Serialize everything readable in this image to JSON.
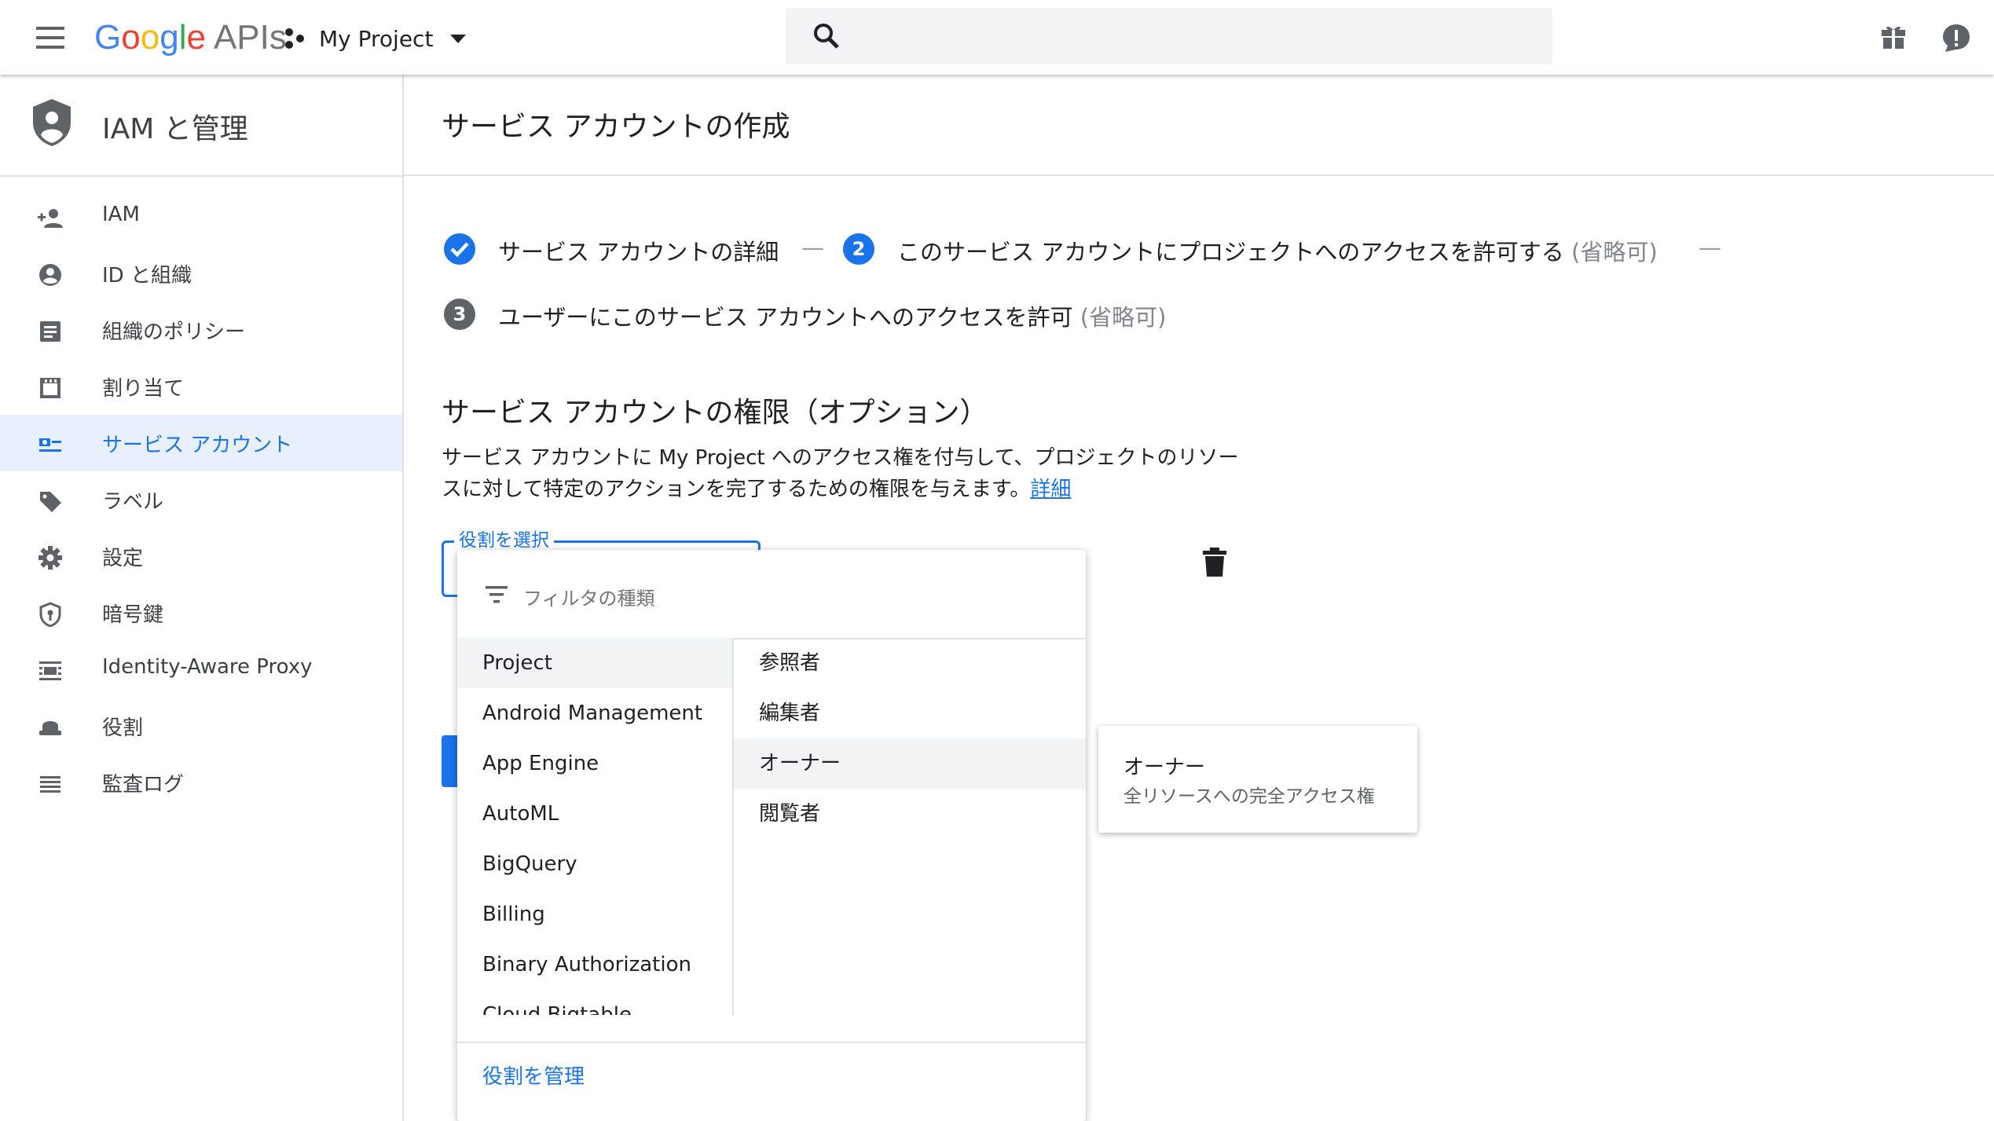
{
  "header": {
    "logo": {
      "G": "G",
      "o1": "o",
      "o2": "o",
      "g": "g",
      "l": "l",
      "e": "e",
      "apis": "APIs"
    },
    "project": "My Project",
    "search_placeholder": ""
  },
  "sidebar": {
    "title": "IAM と管理",
    "items": [
      {
        "label": "IAM",
        "icon": "person-add-icon"
      },
      {
        "label": "ID と組織",
        "icon": "account-circle-icon"
      },
      {
        "label": "組織のポリシー",
        "icon": "policy-document-icon"
      },
      {
        "label": "割り当て",
        "icon": "quota-icon"
      },
      {
        "label": "サービス アカウント",
        "icon": "service-account-icon"
      },
      {
        "label": "ラベル",
        "icon": "label-icon"
      },
      {
        "label": "設定",
        "icon": "settings-icon"
      },
      {
        "label": "暗号鍵",
        "icon": "key-shield-icon"
      },
      {
        "label": "Identity-Aware Proxy",
        "icon": "proxy-icon"
      },
      {
        "label": "役割",
        "icon": "roles-icon"
      },
      {
        "label": "監査ログ",
        "icon": "audit-log-icon"
      }
    ]
  },
  "main": {
    "title": "サービス アカウントの作成",
    "steps": [
      {
        "label": "サービス アカウントの詳細",
        "optional": ""
      },
      {
        "number": "2",
        "label": "このサービス アカウントにプロジェクトへのアクセスを許可する",
        "optional": "(省略可)"
      },
      {
        "number": "3",
        "label": "ユーザーにこのサービス アカウントへのアクセスを許可",
        "optional": "(省略可)"
      }
    ],
    "step_separator": "—",
    "section_title": "サービス アカウントの権限（オプション）",
    "description_line1": "サービス アカウントに My Project へのアクセス権を付与して、プロジェクトのリソー",
    "description_line2": "スに対して特定のアクションを完了するための権限を与えます。",
    "learn_more": "詳細",
    "role_field_label": "役割を選択"
  },
  "dropdown": {
    "filter_placeholder": "フィルタの種類",
    "categories": [
      "Project",
      "Android Management",
      "App Engine",
      "AutoML",
      "BigQuery",
      "Billing",
      "Binary Authorization",
      "Cloud Bigtable"
    ],
    "roles": [
      "参照者",
      "編集者",
      "オーナー",
      "閲覧者"
    ],
    "manage_roles": "役割を管理"
  },
  "role_card": {
    "title": "オーナー",
    "description": "全リソースへの完全アクセス権"
  },
  "colors": {
    "accent": "#1a73e8",
    "highlight": "#e8f0fe"
  }
}
